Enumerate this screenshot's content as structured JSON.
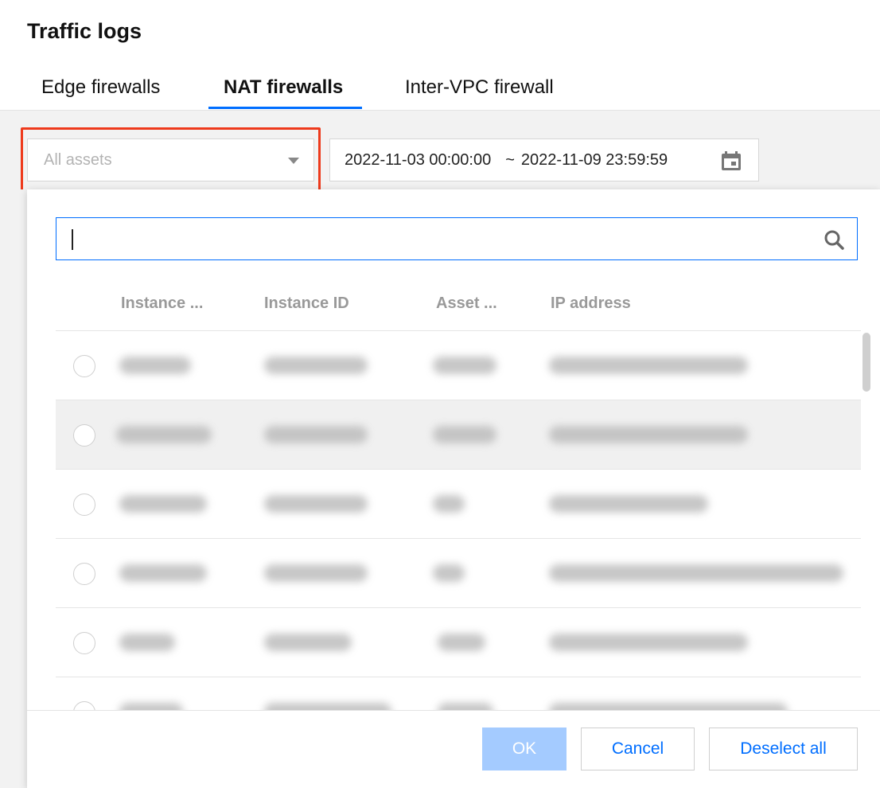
{
  "page": {
    "title": "Traffic logs"
  },
  "tabs": [
    {
      "label": "Edge firewalls",
      "active": false
    },
    {
      "label": "NAT firewalls",
      "active": true
    },
    {
      "label": "Inter-VPC firewall",
      "active": false
    }
  ],
  "filters": {
    "asset_select": {
      "placeholder": "All assets",
      "icon": "caret-down-icon"
    },
    "date_range": {
      "start": "2022-11-03 00:00:00",
      "separator": "~",
      "end": "2022-11-09 23:59:59",
      "icon": "calendar-icon"
    }
  },
  "dropdown": {
    "search": {
      "value": "",
      "placeholder": "",
      "icon": "search-icon"
    },
    "columns": [
      "Instance ...",
      "Instance ID",
      "Asset ...",
      "IP address"
    ],
    "rows_note_hidden": true,
    "buttons": {
      "ok": "OK",
      "cancel": "Cancel",
      "deselect_all": "Deselect all"
    }
  },
  "colors": {
    "accent": "#006eff",
    "highlight": "#ee3a1c",
    "ok_disabled": "#a4cbff"
  }
}
